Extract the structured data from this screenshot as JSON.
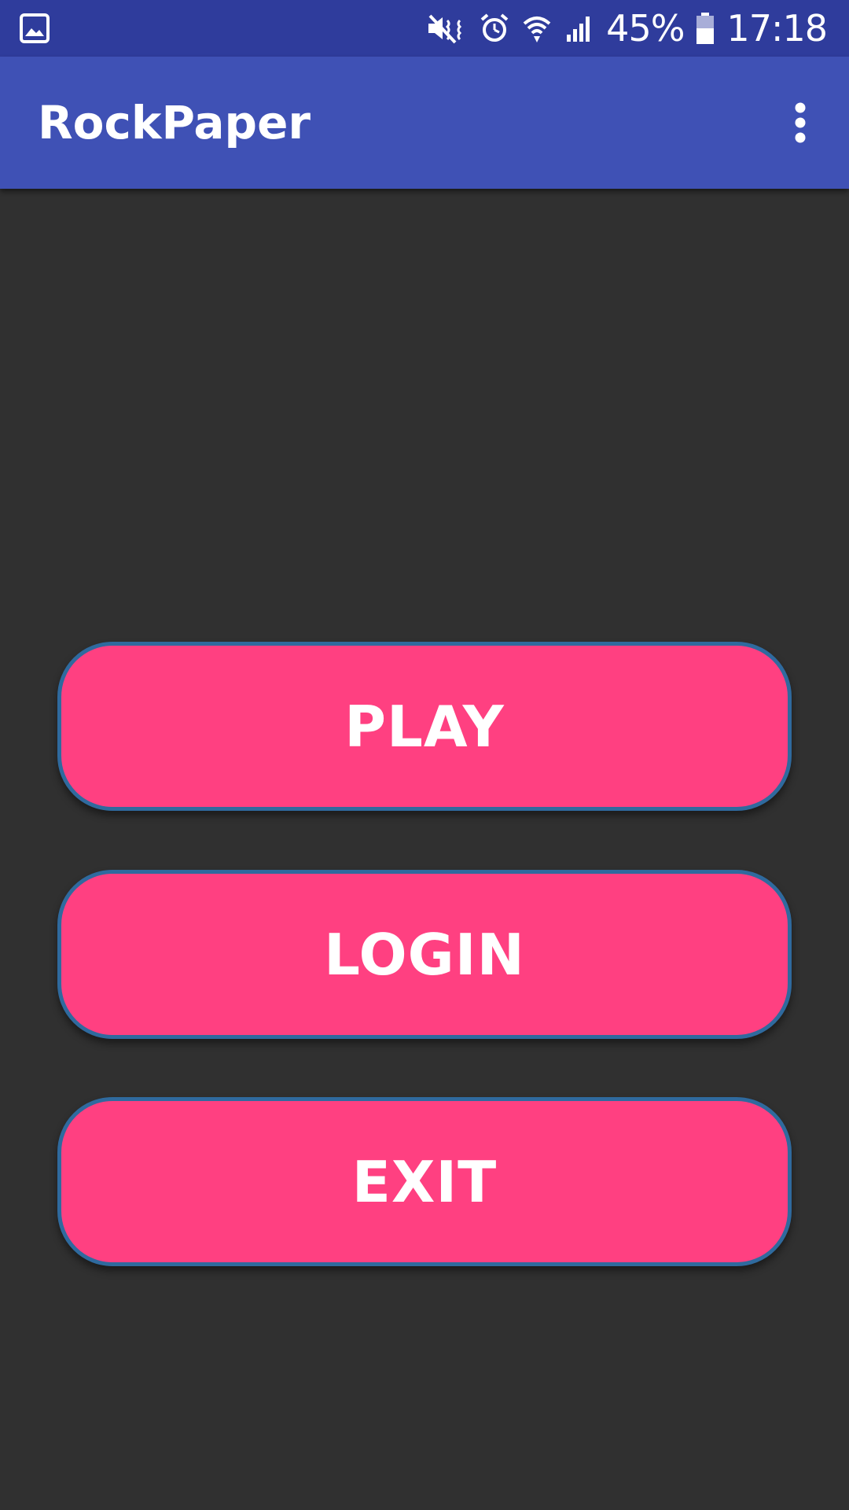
{
  "status_bar": {
    "battery_percent": "45%",
    "time": "17:18",
    "icons": [
      "image-icon",
      "mute-icon",
      "alarm-icon",
      "wifi-icon",
      "signal-icon",
      "battery-icon"
    ]
  },
  "app_bar": {
    "title": "RockPaper",
    "overflow_icon": "more-vert-icon"
  },
  "menu": {
    "play_label": "PLAY",
    "login_label": "LOGIN",
    "exit_label": "EXIT"
  },
  "colors": {
    "status_bar": "#2f3c9c",
    "app_bar": "#3f51b5",
    "background": "#303030",
    "button_fill": "#ff4081",
    "button_border": "#2f6a9e",
    "text": "#ffffff"
  }
}
